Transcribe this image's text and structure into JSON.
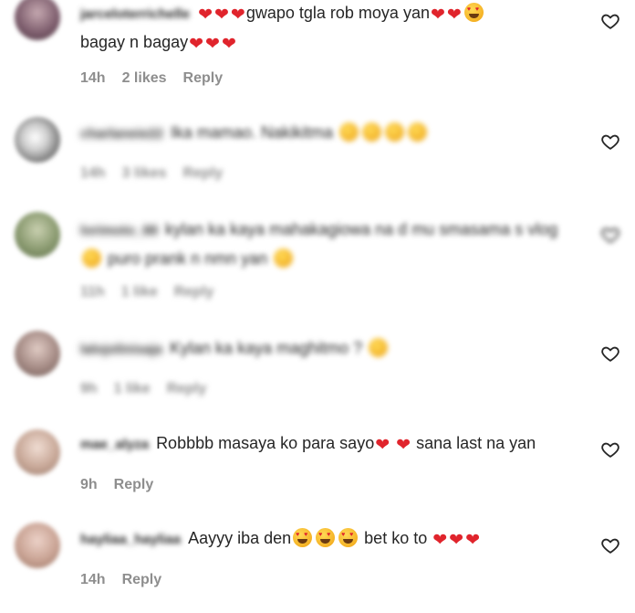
{
  "comments": [
    {
      "username": "jarceloterrichelle",
      "text_parts": [
        "gwapo tgla rob moya yan"
      ],
      "line2": "bagay n bagay",
      "time": "14h",
      "likes": "2 likes",
      "reply": "Reply",
      "avatar_color": "#7a5a6a",
      "blurred": false
    },
    {
      "username": "charlaneie22",
      "text": "Ika mamao. Nakikitma",
      "time": "14h",
      "likes": "3 likes",
      "reply": "Reply",
      "avatar_color": "#9a9a9a",
      "blurred": true
    },
    {
      "username": "lorimoto_88",
      "text": "kylan ka kaya mahakagiowa na d mu smasama s vlog",
      "line2": "puro prank n nmn yan",
      "time": "11h",
      "likes": "1 like",
      "reply": "Reply",
      "avatar_color": "#7f8f6a",
      "blurred": true
    },
    {
      "username": "lalojolinisaja",
      "text": "Kylan ka kaya maghitmo ?",
      "time": "9h",
      "likes": "1 like",
      "reply": "Reply",
      "avatar_color": "#a48a84",
      "blurred": true
    },
    {
      "username": "mae_alyza",
      "text_a": "Robbbb masaya ko para sayo",
      "text_b": "sana last na yan",
      "time": "9h",
      "reply": "Reply",
      "avatar_color": "#c8a898",
      "blurred": false
    },
    {
      "username": "hayliaa_hayliaa",
      "text_a": "Aayyy iba den",
      "text_b": "bet ko to",
      "time": "14h",
      "reply": "Reply",
      "avatar_color": "#c9a394",
      "blurred": false
    }
  ],
  "icons": {
    "heart": "heart-outline-icon"
  },
  "colors": {
    "meta": "#8e8e8e",
    "heart_emoji": "#e0242c"
  }
}
